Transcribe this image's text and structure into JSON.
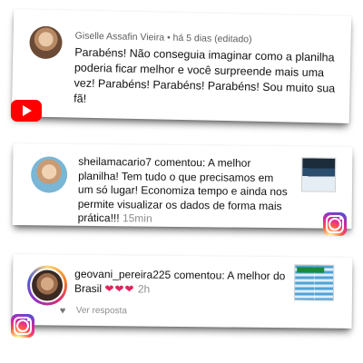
{
  "youtube_comment": {
    "author": "Giselle Assafin Vieira",
    "meta": "• há 5 dias (editado)",
    "text": "Parabéns! Não conseguia imaginar como a planilha poderia ficar melhor e você surpreende mais uma vez! Parabéns! Parabéns! Parabéns! Sou muito sua fã!",
    "logo_icon": "youtube-logo-icon"
  },
  "instagram_comment_1": {
    "username": "sheilamacario7",
    "verb": " comentou: ",
    "text": "A melhor planilha! Tem tudo o que precisamos em um só lugar! Economiza tempo e ainda nos permite visualizar os dados de forma mais prática!!!",
    "time": "15min",
    "logo_icon": "instagram-logo-icon"
  },
  "instagram_comment_2": {
    "username": "geovani_pereira225",
    "verb": " comentou: ",
    "text": "A melhor do Brasil ",
    "hearts": "❤❤❤",
    "time": "2h",
    "reply_label": "Ver resposta",
    "logo_icon": "instagram-logo-icon"
  },
  "colors": {
    "youtube_red": "#ff0000",
    "meta_gray": "#606060",
    "time_gray": "#8e8e8e",
    "heart_red": "#e0245e"
  }
}
